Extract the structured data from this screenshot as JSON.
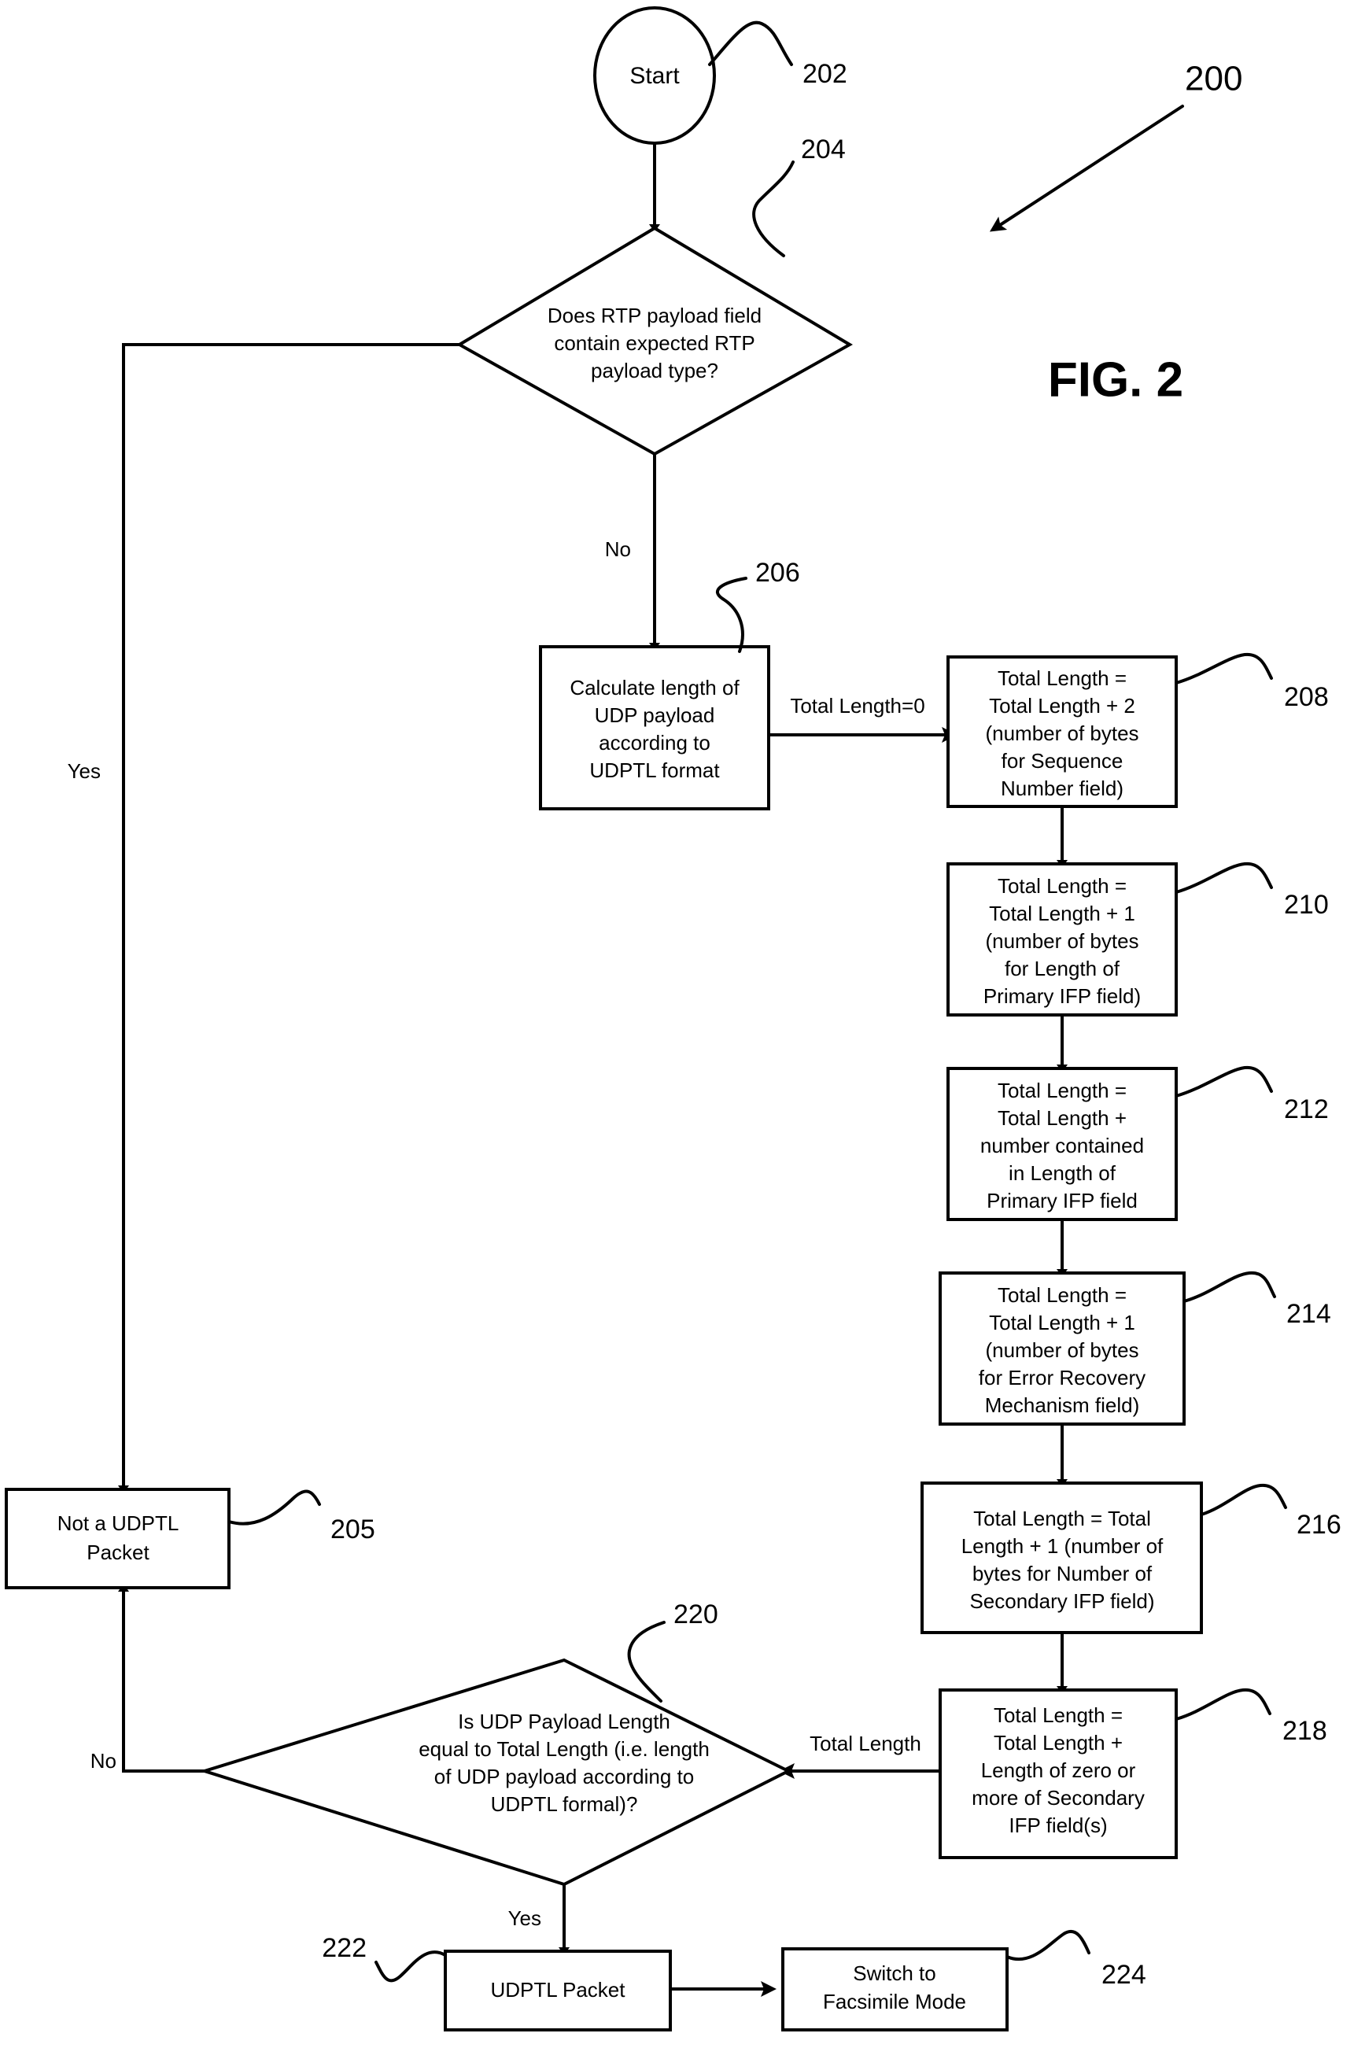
{
  "figure": {
    "label": "FIG. 2",
    "overall_ref": "200"
  },
  "nodes": {
    "start": {
      "ref": "202",
      "shape": "ellipse",
      "lines": [
        "Start"
      ]
    },
    "decision_rtp": {
      "ref": "204",
      "shape": "diamond",
      "lines": [
        "Does RTP payload field",
        "contain expected RTP",
        "payload type?"
      ]
    },
    "not_udptl": {
      "ref": "205",
      "shape": "rect",
      "lines": [
        "Not a UDPTL",
        "Packet"
      ]
    },
    "calc_length": {
      "ref": "206",
      "shape": "rect",
      "lines": [
        "Calculate length of",
        "UDP payload",
        "according to",
        "UDPTL format"
      ]
    },
    "seq_number": {
      "ref": "208",
      "shape": "rect",
      "lines": [
        "Total Length =",
        "Total Length + 2",
        "(number of bytes",
        "for Sequence",
        "Number field)"
      ]
    },
    "primary_ifp_len": {
      "ref": "210",
      "shape": "rect",
      "lines": [
        "Total Length =",
        "Total Length + 1",
        "(number of bytes",
        "for Length of",
        "Primary IFP field)"
      ]
    },
    "primary_ifp_contained": {
      "ref": "212",
      "shape": "rect",
      "lines": [
        "Total Length =",
        "Total Length +",
        "number contained",
        "in Length of",
        "Primary IFP field"
      ]
    },
    "error_recovery": {
      "ref": "214",
      "shape": "rect",
      "lines": [
        "Total Length =",
        "Total Length + 1",
        "(number of bytes",
        "for Error Recovery",
        "Mechanism field)"
      ]
    },
    "secondary_ifp_num": {
      "ref": "216",
      "shape": "rect",
      "lines": [
        "Total Length = Total",
        "Length + 1 (number of",
        "bytes for Number of",
        "Secondary IFP field)"
      ]
    },
    "secondary_ifp_len": {
      "ref": "218",
      "shape": "rect",
      "lines": [
        "Total Length =",
        "Total Length +",
        "Length of zero or",
        "more of Secondary",
        "IFP field(s)"
      ]
    },
    "decision_udp_len": {
      "ref": "220",
      "shape": "diamond",
      "lines": [
        "Is UDP Payload Length",
        "equal to Total Length (i.e. length",
        "of UDP payload according to",
        "UDPTL formal)?"
      ]
    },
    "udptl_packet": {
      "ref": "222",
      "shape": "rect",
      "lines": [
        "UDPTL Packet"
      ]
    },
    "switch_fax": {
      "ref": "224",
      "shape": "rect",
      "lines": [
        "Switch to",
        "Facsimile Mode"
      ]
    }
  },
  "edge_labels": {
    "rtp_yes": "Yes",
    "rtp_no": "No",
    "total_length_zero": "Total Length=0",
    "total_length": "Total Length",
    "udp_no": "No",
    "udp_yes": "Yes"
  },
  "colors": {
    "ink": "#000000",
    "paper": "#ffffff"
  }
}
